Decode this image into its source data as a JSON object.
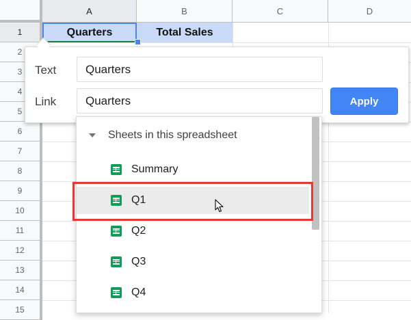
{
  "columns": [
    "A",
    "B",
    "C",
    "D"
  ],
  "rows": [
    "1",
    "2",
    "3",
    "4",
    "5",
    "6",
    "7",
    "8",
    "9",
    "10",
    "11",
    "12",
    "13",
    "14",
    "15"
  ],
  "cells": {
    "A1": "Quarters",
    "B1": "Total Sales"
  },
  "link_editor": {
    "text_label": "Text",
    "text_value": "Quarters",
    "link_label": "Link",
    "link_value": "Quarters",
    "apply_label": "Apply"
  },
  "dropdown": {
    "section_title": "Sheets in this spreadsheet",
    "items": [
      "Summary",
      "Q1",
      "Q2",
      "Q3",
      "Q4"
    ],
    "hovered": "Q1"
  },
  "colors": {
    "accent": "#4285f4",
    "selection": "#c9daf8",
    "sheet_icon": "#0f9d58",
    "highlight": "#e53935"
  }
}
